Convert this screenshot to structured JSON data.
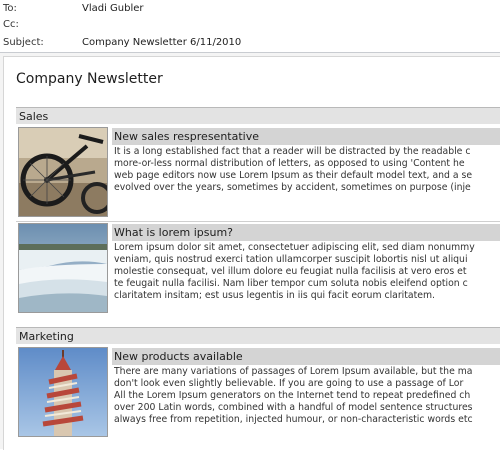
{
  "header": {
    "to_label": "To:",
    "to_value": "Vladi Gubler",
    "cc_label": "Cc:",
    "cc_value": "",
    "subject_label": "Subject:",
    "subject_value": "Company Newsletter 6/11/2010"
  },
  "newsletter": {
    "title": "Company Newsletter",
    "sections": [
      {
        "name": "Sales",
        "articles": [
          {
            "image": "bicycle-photo",
            "title": "New sales respresentative",
            "lines": [
              "It is a long established fact that a reader will be distracted by the readable c",
              "more-or-less normal distribution of letters, as opposed to using 'Content he",
              "web page editors now use Lorem Ipsum as their default model text, and a se",
              "evolved over the years, sometimes by accident, sometimes on purpose (inje"
            ]
          },
          {
            "image": "waterfall-photo",
            "title": "What is lorem ipsum?",
            "lines": [
              "Lorem ipsum dolor sit amet, consectetuer adipiscing elit, sed diam nonummy",
              "veniam, quis nostrud exerci tation ullamcorper suscipit lobortis nisl ut aliqui",
              "molestie consequat, vel illum dolore eu feugiat nulla facilisis at vero eros et",
              "te feugait nulla facilisi. Nam liber tempor cum soluta nobis eleifend option c",
              "claritatem insitam; est usus legentis in iis qui facit eorum claritatem."
            ]
          }
        ]
      },
      {
        "name": "Marketing",
        "articles": [
          {
            "image": "helter-skelter-photo",
            "title": "New products available",
            "lines": [
              "There are many variations of passages of Lorem Ipsum available, but the ma",
              "don't look even slightly believable. If you are going to use a passage of Lor",
              "All the Lorem Ipsum generators on the Internet tend to repeat predefined ch",
              "over 200 Latin words, combined with a handful of model sentence structures",
              "always free from repetition, injected humour, or non-characteristic words etc"
            ]
          }
        ]
      }
    ]
  }
}
